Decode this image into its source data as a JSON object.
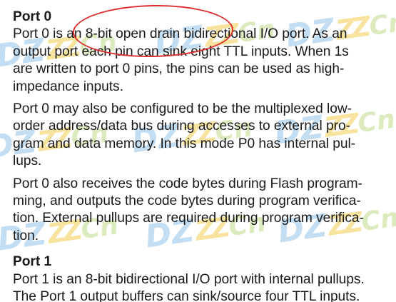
{
  "watermark": {
    "text_dz": "DZ",
    "text_z": "ZZ",
    "text_cn": "Cn"
  },
  "sections": [
    {
      "heading": "Port 0",
      "paragraphs": [
        "Port 0 is an 8-bit open drain bidirectional I/O port. As an\noutput port each pin can sink eight TTL inputs. When 1s\nare written to port 0 pins, the pins can be used as high-\nimpedance inputs.",
        "Port 0 may also be configured to be the multiplexed low-\norder address/data bus during accesses to external pro-\ngram and data memory. In this mode P0 has internal pul-\nlups.",
        "Port 0 also receives the code bytes during Flash program-\nming, and outputs the code bytes during program verifica-\ntion. External pullups are required during program verifica-\ntion."
      ]
    },
    {
      "heading": "Port 1",
      "paragraphs": [
        "Port 1 is an 8-bit bidirectional I/O port with internal pullups.\nThe Port 1 output buffers can sink/source four TTL inputs."
      ]
    }
  ]
}
